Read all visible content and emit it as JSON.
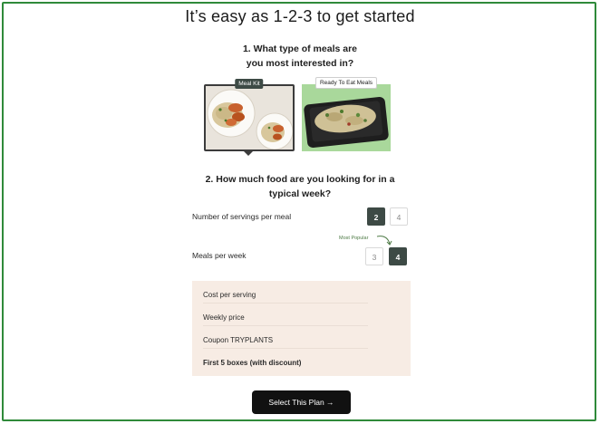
{
  "title": "It’s easy as 1-2-3 to get started",
  "question1": {
    "line1": "1. What type of meals are",
    "line2": "you most interested in?"
  },
  "meal_types": [
    {
      "label": "Meal Kit",
      "selected": true
    },
    {
      "label": "Ready To Eat Meals",
      "selected": false
    }
  ],
  "question2": {
    "line1": "2. How much food are you looking for in a",
    "line2": "typical week?"
  },
  "servings": {
    "label": "Number of servings per meal",
    "options": [
      "2",
      "4"
    ],
    "selected": "2"
  },
  "meals": {
    "label": "Meals per week",
    "popular_tag": "Most Popular",
    "options": [
      "3",
      "4"
    ],
    "selected": "4"
  },
  "summary": {
    "cost_per_serving": "Cost per serving",
    "weekly_price": "Weekly price",
    "coupon": "Coupon TRYPLANTS",
    "first_boxes": "First 5 boxes (with discount)"
  },
  "cta": {
    "label": "Select This Plan →"
  },
  "colors": {
    "accent": "#3d4a45",
    "frame_border": "#2f8a3a",
    "summary_bg": "#f7ece4",
    "cta_bg": "#111111"
  }
}
